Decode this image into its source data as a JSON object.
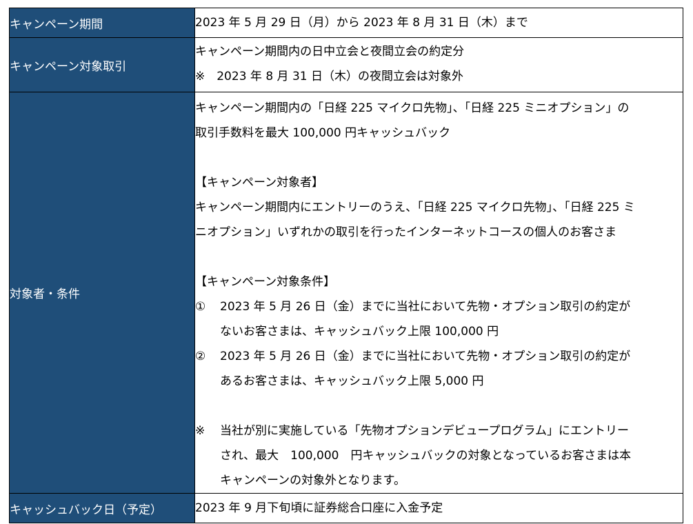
{
  "rows": [
    {
      "label": "キャンペーン期間",
      "value": [
        "2023 年 5 月 29 日（月）から 2023 年 8 月 31 日（木）まで"
      ]
    },
    {
      "label": "キャンペーン対象取引",
      "value": [
        "キャンペーン期間内の日中立会と夜間立会の約定分",
        "※　2023 年 8 月 31 日（木）の夜間立会は対象外"
      ]
    },
    {
      "label": "対象者・条件",
      "intro": [
        "キャンペーン期間内の「日経 225 マイクロ先物」、「日経 225 ミニオプション」の",
        "取引手数料を最大 100,000 円キャッシュバック"
      ],
      "target_heading": "【キャンペーン対象者】",
      "target_text": [
        "キャンペーン期間内にエントリーのうえ、「日経 225 マイクロ先物」、「日経 225 ミ",
        "ニオプション」いずれかの取引を行ったインターネットコースの個人のお客さま"
      ],
      "conditions_heading": "【キャンペーン対象条件】",
      "conditions": [
        {
          "mark": "①",
          "lines": [
            "2023 年 5 月 26 日（金）までに当社において先物・オプション取引の約定が",
            "ないお客さまは、キャッシュバック上限 100,000 円"
          ]
        },
        {
          "mark": "②",
          "lines": [
            "2023 年 5 月 26 日（金）までに当社において先物・オプション取引の約定が",
            "あるお客さまは、キャッシュバック上限 5,000 円"
          ]
        }
      ],
      "note": {
        "mark": "※",
        "lines": [
          "当社が別に実施している「先物オプションデビュープログラム」にエントリー",
          "され、最大　100,000　円キャッシュバックの対象となっているお客さまは本",
          "キャンペーンの対象外となります。"
        ]
      }
    },
    {
      "label": "キャッシュバック日（予定）",
      "value": [
        "2023 年 9 月下旬頃に証券総合口座に入金予定"
      ]
    }
  ],
  "colors": {
    "label_bg": "#1f4e79",
    "label_text": "#ffffff",
    "border": "#000000"
  }
}
